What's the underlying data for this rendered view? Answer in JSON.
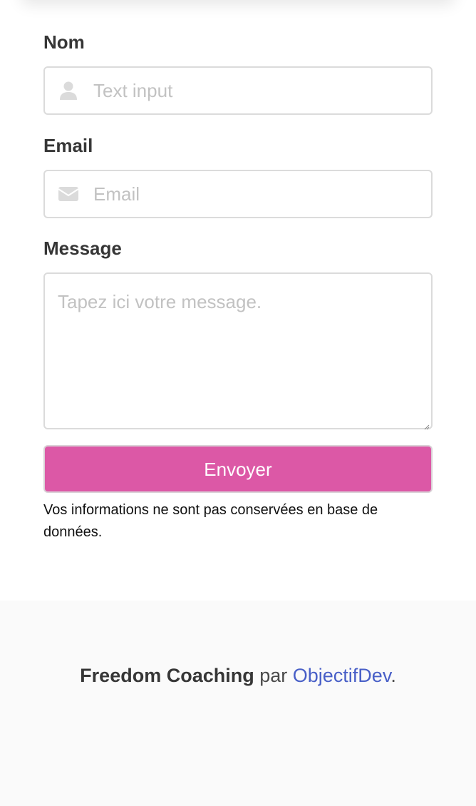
{
  "form": {
    "name": {
      "label": "Nom",
      "placeholder": "Text input",
      "icon": "user-icon"
    },
    "email": {
      "label": "Email",
      "placeholder": "Email",
      "icon": "envelope-icon"
    },
    "message": {
      "label": "Message",
      "placeholder": "Tapez ici votre message."
    },
    "submit_label": "Envoyer",
    "notice": "Vos informations ne sont pas conservées en base de données."
  },
  "footer": {
    "brand": "Freedom Coaching",
    "by": "par",
    "link_label": "ObjectifDev",
    "suffix": "."
  },
  "colors": {
    "accent": "#dc58a6",
    "link": "#485fc7",
    "icon": "#dbdbdb",
    "footer_bg": "#fafafa"
  }
}
